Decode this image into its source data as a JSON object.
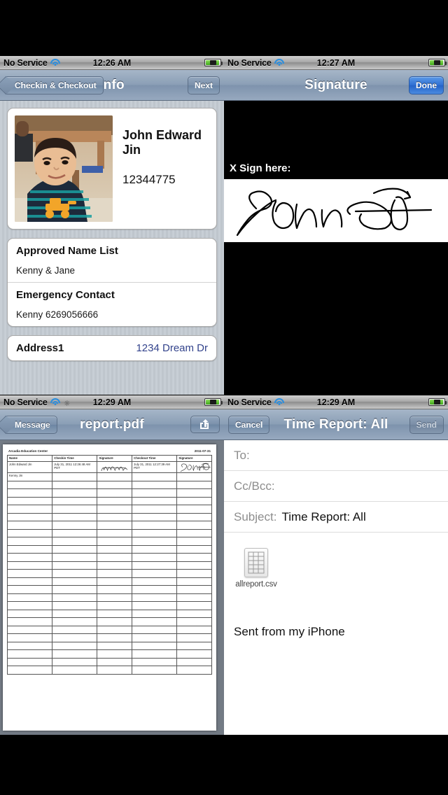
{
  "panels": {
    "info": {
      "status": {
        "carrier": "No Service",
        "time": "12:26 AM",
        "wifi_icon": "wifi-icon",
        "battery_icon": "battery-charging-icon"
      },
      "nav": {
        "back_label": "Checkin & Checkout",
        "title": "Info",
        "next_label": "Next"
      },
      "card": {
        "name": "John Edward Jin",
        "id": "12344775",
        "photo_alt": "child-photo"
      },
      "sections": [
        {
          "title": "Approved Name List",
          "value": "Kenny & Jane"
        },
        {
          "title": "Emergency Contact",
          "value": "Kenny 6269056666"
        }
      ],
      "address_row": {
        "key": "Address1",
        "value": "1234 Dream Dr"
      }
    },
    "signature": {
      "status": {
        "carrier": "No Service",
        "time": "12:27 AM",
        "wifi_icon": "wifi-icon",
        "battery_icon": "battery-charging-icon"
      },
      "nav": {
        "title": "Signature",
        "done_label": "Done"
      },
      "prompt": "X Sign here:",
      "signature_alt": "handwritten-signature-john"
    },
    "pdf": {
      "status": {
        "carrier": "No Service",
        "time": "12:29 AM",
        "wifi_icon": "wifi-icon",
        "spinner_icon": "activity-spinner-icon",
        "battery_icon": "battery-charging-icon"
      },
      "nav": {
        "back_label": "Message",
        "title": "report.pdf",
        "share_icon": "share-export-icon"
      },
      "document": {
        "org": "Arcadia Education Center",
        "date": "2011-07-31",
        "columns": [
          "Name",
          "Checkin Time",
          "Signature",
          "Checkout Time",
          "Signature"
        ],
        "rows": [
          {
            "name": "John Edward Jin",
            "checkin": "July 31, 2011 12:26:48 AM PDT",
            "checkin_sig": "scribble-signature",
            "checkout": "July 31, 2011 12:27:39 AM PDT",
            "checkout_sig": "john-signature"
          },
          {
            "name": "Kenny Jin",
            "checkin": "",
            "checkin_sig": "",
            "checkout": "",
            "checkout_sig": ""
          }
        ],
        "empty_row_count": 24
      }
    },
    "mail": {
      "status": {
        "carrier": "No Service",
        "time": "12:29 AM",
        "wifi_icon": "wifi-icon",
        "battery_icon": "battery-charging-icon"
      },
      "nav": {
        "cancel_label": "Cancel",
        "title": "Time Report: All",
        "send_label": "Send"
      },
      "fields": [
        {
          "label": "To:",
          "value": ""
        },
        {
          "label": "Cc/Bcc:",
          "value": ""
        },
        {
          "label": "Subject:",
          "value": "Time Report: All"
        }
      ],
      "attachment": {
        "name": "allreport.csv",
        "icon": "csv-file-icon"
      },
      "body": "Sent from my iPhone"
    }
  },
  "colors": {
    "accent_blue": "#2f6fd3",
    "nav_blue": "#8b9fb6",
    "link_blue": "#33438c"
  }
}
